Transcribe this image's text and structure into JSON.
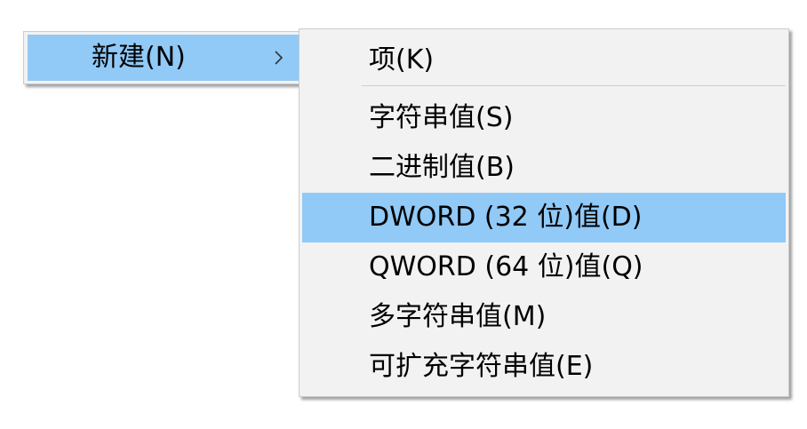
{
  "parent_menu": {
    "new_item": {
      "label": "新建(N)",
      "chevron": "chevron-right-icon"
    }
  },
  "submenu": {
    "items": [
      {
        "label": "项(K)",
        "highlighted": false
      },
      {
        "label": "字符串值(S)",
        "highlighted": false
      },
      {
        "label": "二进制值(B)",
        "highlighted": false
      },
      {
        "label": "DWORD (32 位)值(D)",
        "highlighted": true
      },
      {
        "label": "QWORD (64 位)值(Q)",
        "highlighted": false
      },
      {
        "label": "多字符串值(M)",
        "highlighted": false
      },
      {
        "label": "可扩充字符串值(E)",
        "highlighted": false
      }
    ]
  },
  "colors": {
    "menu_background": "#f2f2f2",
    "highlight": "#91c9f7",
    "border": "#cccccc",
    "separator": "#cfcfcf"
  }
}
